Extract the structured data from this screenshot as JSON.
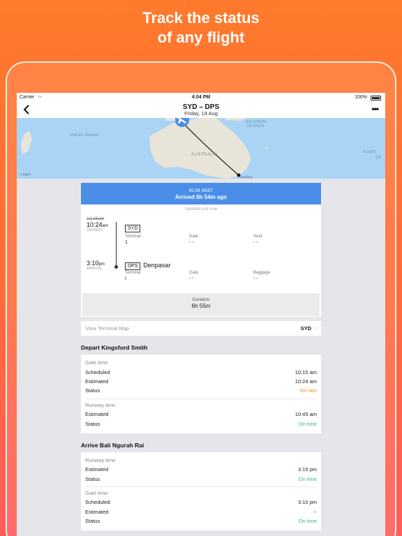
{
  "promo": {
    "line1": "Track the status",
    "line2": "of any flight"
  },
  "status_bar": {
    "carrier": "Carrier",
    "time": "4:04 PM",
    "battery": "100%"
  },
  "nav": {
    "title": "SYD – DPS",
    "subtitle": "Friday, 18 Aug"
  },
  "map": {
    "labels": {
      "indian_ocean": "Indian Ocean",
      "australia": "AUSTRALIA",
      "solomon": "SOLOMON",
      "islands": "ISLANDS",
      "south": "South",
      "oc": "Oc",
      "sydney": "Sydney",
      "legal": "Legal"
    }
  },
  "flight": {
    "number": "KLM 4047",
    "arrival_status": "Arrived 6h 54m ago",
    "updated": "Updated just now",
    "depart": {
      "scheduled": "10:15am",
      "time": "10:24",
      "ampm": "am",
      "caption": "DEPART",
      "code": "SYD",
      "terminal_label": "Terminal",
      "terminal": "1",
      "gate_label": "Gate",
      "gate": "- -",
      "seat_label": "Seat",
      "seat": "- -"
    },
    "arrive": {
      "time": "3:10",
      "ampm": "pm",
      "caption": "ARRIVE",
      "code": "DPS",
      "city": "Denpasar",
      "terminal_label": "Terminal",
      "terminal": "I",
      "gate_label": "Gate",
      "gate": "- -",
      "baggage_label": "Baggage",
      "baggage": "- -"
    },
    "duration_label": "Duration",
    "duration": "6h 55m"
  },
  "terminal_map": {
    "label": "View Terminal Map",
    "code": "SYD"
  },
  "depart_section": {
    "title": "Depart Kingsford Smith",
    "gate_head": "Gate time",
    "gate_scheduled_label": "Scheduled",
    "gate_scheduled": "10:15 am",
    "gate_estimated_label": "Estimated",
    "gate_estimated": "10:24 am",
    "gate_status_label": "Status",
    "gate_status": "9m late",
    "runway_head": "Runway time",
    "runway_estimated_label": "Estimated",
    "runway_estimated": "10:45 am",
    "runway_status_label": "Status",
    "runway_status": "On time"
  },
  "arrive_section": {
    "title": "Arrive Bali Ngurah Rai",
    "runway_head": "Runway time",
    "runway_estimated_label": "Estimated",
    "runway_estimated": "3:15 pm",
    "runway_status_label": "Status",
    "runway_status": "On time",
    "gate_head": "Gate time",
    "gate_scheduled_label": "Scheduled",
    "gate_scheduled": "3:10 pm",
    "gate_estimated_label": "Estimated",
    "gate_estimated": "--",
    "gate_status_label": "Status",
    "gate_status": "On time"
  },
  "colors": {
    "accent": "#4a8ee8",
    "late": "#f0962a",
    "ok": "#3bb878"
  }
}
